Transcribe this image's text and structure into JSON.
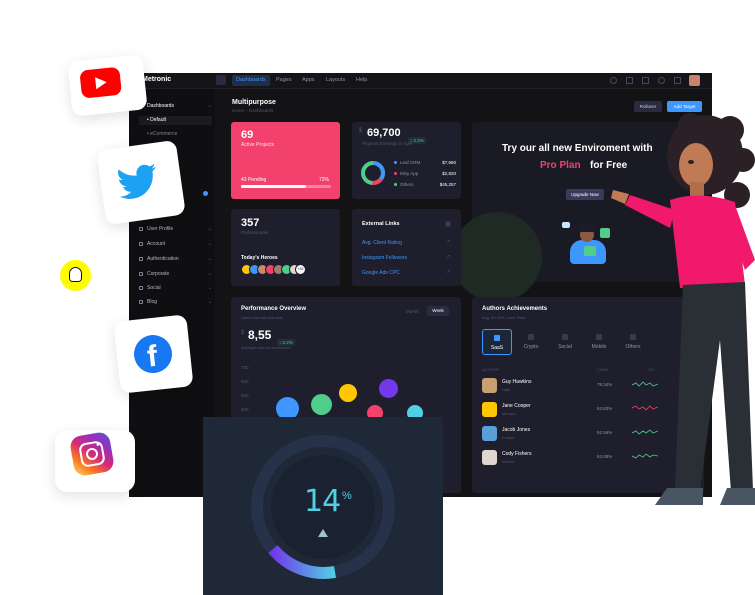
{
  "app": {
    "brand": "Metronic"
  },
  "topnav": {
    "items": [
      "Dashboards",
      "Pages",
      "Apps",
      "Layouts",
      "Help"
    ],
    "active": "Dashboards"
  },
  "sidebar": {
    "items": [
      {
        "label": "Dashboards"
      },
      {
        "label": "Default"
      },
      {
        "label": "eCommerce"
      },
      {
        "label": "User Profile"
      },
      {
        "label": "Account"
      },
      {
        "label": "Authentication"
      },
      {
        "label": "Corporate"
      },
      {
        "label": "Social"
      },
      {
        "label": "Blog"
      }
    ]
  },
  "page": {
    "title": "Multipurpose",
    "breadcrumb": "Home – Dashboards",
    "rollover_label": "Rollover",
    "add_target_label": "Add Target"
  },
  "projects": {
    "value": "69",
    "label": "Active Projects",
    "pending_label": "43 Pending",
    "percent": "72%",
    "progress": 72
  },
  "earnings": {
    "value": "69,700",
    "change": "↑ 2.2%",
    "label": "Projects Earnings in April",
    "legend": [
      {
        "label": "Leaf CRM",
        "value": "$7,660",
        "color": "#3e97ff"
      },
      {
        "label": "Mivy App",
        "value": "$2,820",
        "color": "#f1416c"
      },
      {
        "label": "Others",
        "value": "$45,257",
        "color": "#50cd89"
      }
    ]
  },
  "promo": {
    "headline": "Try our all new Enviroment with",
    "highlight": "Pro Plan",
    "suffix": "for Free",
    "button": "Upgrade Now"
  },
  "professionals": {
    "value": "357",
    "label": "Professionals",
    "heroes_label": "Today's Heroes",
    "more": "+42"
  },
  "links": {
    "title": "External Links",
    "items": [
      "Avg. Client Rating",
      "Instagram Followers",
      "Google Ads CPC"
    ]
  },
  "performance": {
    "title": "Performance Overview",
    "subtitle": "Users from all channels",
    "value": "8,55",
    "currency": "$",
    "change": "↑ 2.2%",
    "caption": "Average cost per interaction",
    "tabs": [
      "Month",
      "Week"
    ],
    "active_tab": "Week",
    "yticks": [
      "700",
      "600",
      "500",
      "400",
      "300"
    ]
  },
  "authors": {
    "title": "Authors Achievements",
    "subtitle": "Avg. 69.34% Conv. Rate",
    "tabs": [
      "SaaS",
      "Crypto",
      "Social",
      "Mobile",
      "Others"
    ],
    "active_tab": "SaaS",
    "header_author": "AUTHOR",
    "header_conv": "CONV.",
    "header_chart": "CH",
    "rows": [
      {
        "name": "Guy Hawkins",
        "company": "Haiti",
        "conv": "78.34%",
        "trend": "green"
      },
      {
        "name": "Jane Cooper",
        "company": "Monaco",
        "conv": "63.83%",
        "trend": "red"
      },
      {
        "name": "Jacob Jones",
        "company": "Poland",
        "conv": "92.56%",
        "trend": "green"
      },
      {
        "name": "Cody Fishers",
        "company": "Mexico",
        "conv": "63.08%",
        "trend": "green"
      }
    ]
  },
  "gauge": {
    "value": "14",
    "unit": "%",
    "level": 0.14
  },
  "colors": {
    "accent": "#3e97ff",
    "pink": "#f1416c",
    "bg": "#131316",
    "card": "#1e1e2d",
    "panel": "#1e2837",
    "teal": "#4fd1e3"
  },
  "social": [
    "youtube-icon",
    "twitter-icon",
    "snapchat-icon",
    "facebook-icon",
    "instagram-icon"
  ]
}
